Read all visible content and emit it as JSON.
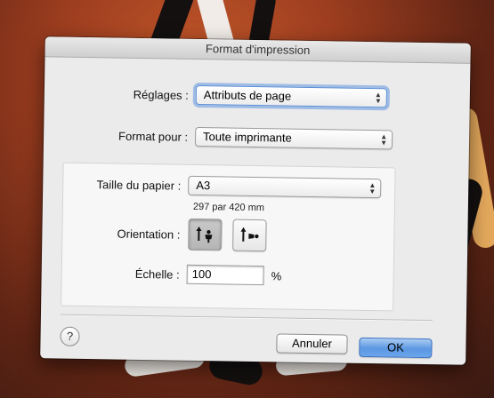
{
  "window": {
    "title": "Format d'impression"
  },
  "settings": {
    "label": "Réglages :",
    "value": "Attributs de page"
  },
  "format_for": {
    "label": "Format pour :",
    "value": "Toute imprimante"
  },
  "paper": {
    "label": "Taille du papier :",
    "value": "A3",
    "dimensions": "297 par 420 mm"
  },
  "orientation": {
    "label": "Orientation :",
    "options": [
      "portrait-icon",
      "landscape-icon"
    ],
    "selected": "portrait-icon"
  },
  "scale": {
    "label": "Échelle :",
    "value": "100",
    "unit": "%"
  },
  "buttons": {
    "help": "?",
    "cancel": "Annuler",
    "ok": "OK"
  },
  "colors": {
    "accent": "#5b97e2",
    "focus_ring": "#6096e0"
  }
}
